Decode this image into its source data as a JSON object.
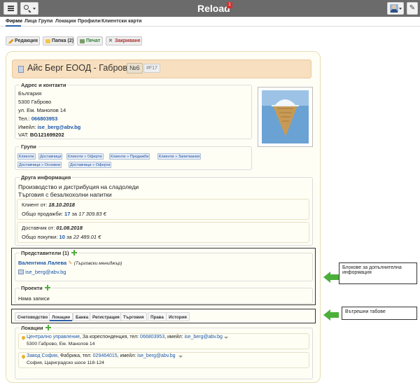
{
  "app": {
    "title": "Reload",
    "notification_count": "1"
  },
  "nav": {
    "items": [
      "Фирми",
      "Лица",
      "Групи",
      "Локации",
      "Профили",
      "Клиентски карти"
    ]
  },
  "actions": {
    "edit": "Редакция",
    "folder": "Папка (2)",
    "print": "Печат",
    "close": "Закриване"
  },
  "company": {
    "name": "Айс Берг ЕООД - Габрово",
    "number": "№6",
    "code": "#F17"
  },
  "address": {
    "legend": "Адрес и контакти",
    "country": "България",
    "city": "5300 Габрово",
    "street": "ул. Ем. Манолов 14",
    "phone_label": "Тел.:",
    "phone": "066803953",
    "email_label": "Имейл:",
    "email": "ise_berg@abv.bg",
    "vat_label": "VAT:",
    "vat": "BG121699202"
  },
  "groups": {
    "legend": "Групи",
    "tags": [
      "Клиенти",
      "Доставчици",
      "Клиенти » Оферти",
      "Клиенти » Продажби",
      "Клиенти » Запитвания",
      "Доставчици » Основни",
      "Доставчици » Оферти"
    ]
  },
  "other": {
    "legend": "Друга информация",
    "line1": "Производство и дистрибуция на сладоледи",
    "line2": "Търговия с безалкохолни напитки",
    "client_label": "Клиент от:",
    "client_date": "18.10.2018",
    "sales_label": "Общо продажби:",
    "sales_count": "17",
    "sales_for": "за",
    "sales_total": "17 309.83 €",
    "supplier_label": "Доставчик от:",
    "supplier_date": "01.08.2018",
    "purchases_label": "Общо покупки:",
    "purchases_count": "10",
    "purchases_for": "за",
    "purchases_total": "22 489.01 €"
  },
  "representatives": {
    "legend": "Представители (1)",
    "name": "Валентина Лалева",
    "role": "(Търговски мениджър)",
    "email": "ise_berg@abv.bg"
  },
  "projects": {
    "legend": "Проекти",
    "empty": "Няма записи"
  },
  "internal_tabs": [
    "Счетоводство",
    "Локации",
    "Банка",
    "Регистрация",
    "Търговия",
    "Права",
    "История"
  ],
  "locations": {
    "legend": "Локации",
    "items": [
      {
        "name": "Централно управление",
        "details": ", За кореспонденция, тел:",
        "phone": "066803953",
        "email_label": ", имейл:",
        "email": "ise_berg@abv.bg",
        "address": "5300 Габрово, Ем. Манолов 14"
      },
      {
        "name": "Завод София",
        "details": ", Фабрика, тел:",
        "phone": "029464015",
        "email_label": ", имейл:",
        "email": "ise_berg@abv.bg",
        "address": "София, Цариградско шосе 118-124"
      }
    ]
  },
  "callouts": {
    "blocks": "Блокове за допълнителна информация",
    "tabs": "Вътрешни табове"
  },
  "colors": {
    "topbar": "#6b6b6b",
    "link": "#1a56a8",
    "accent_green": "#4caf3a",
    "title_bg": "#f7dfbf"
  }
}
